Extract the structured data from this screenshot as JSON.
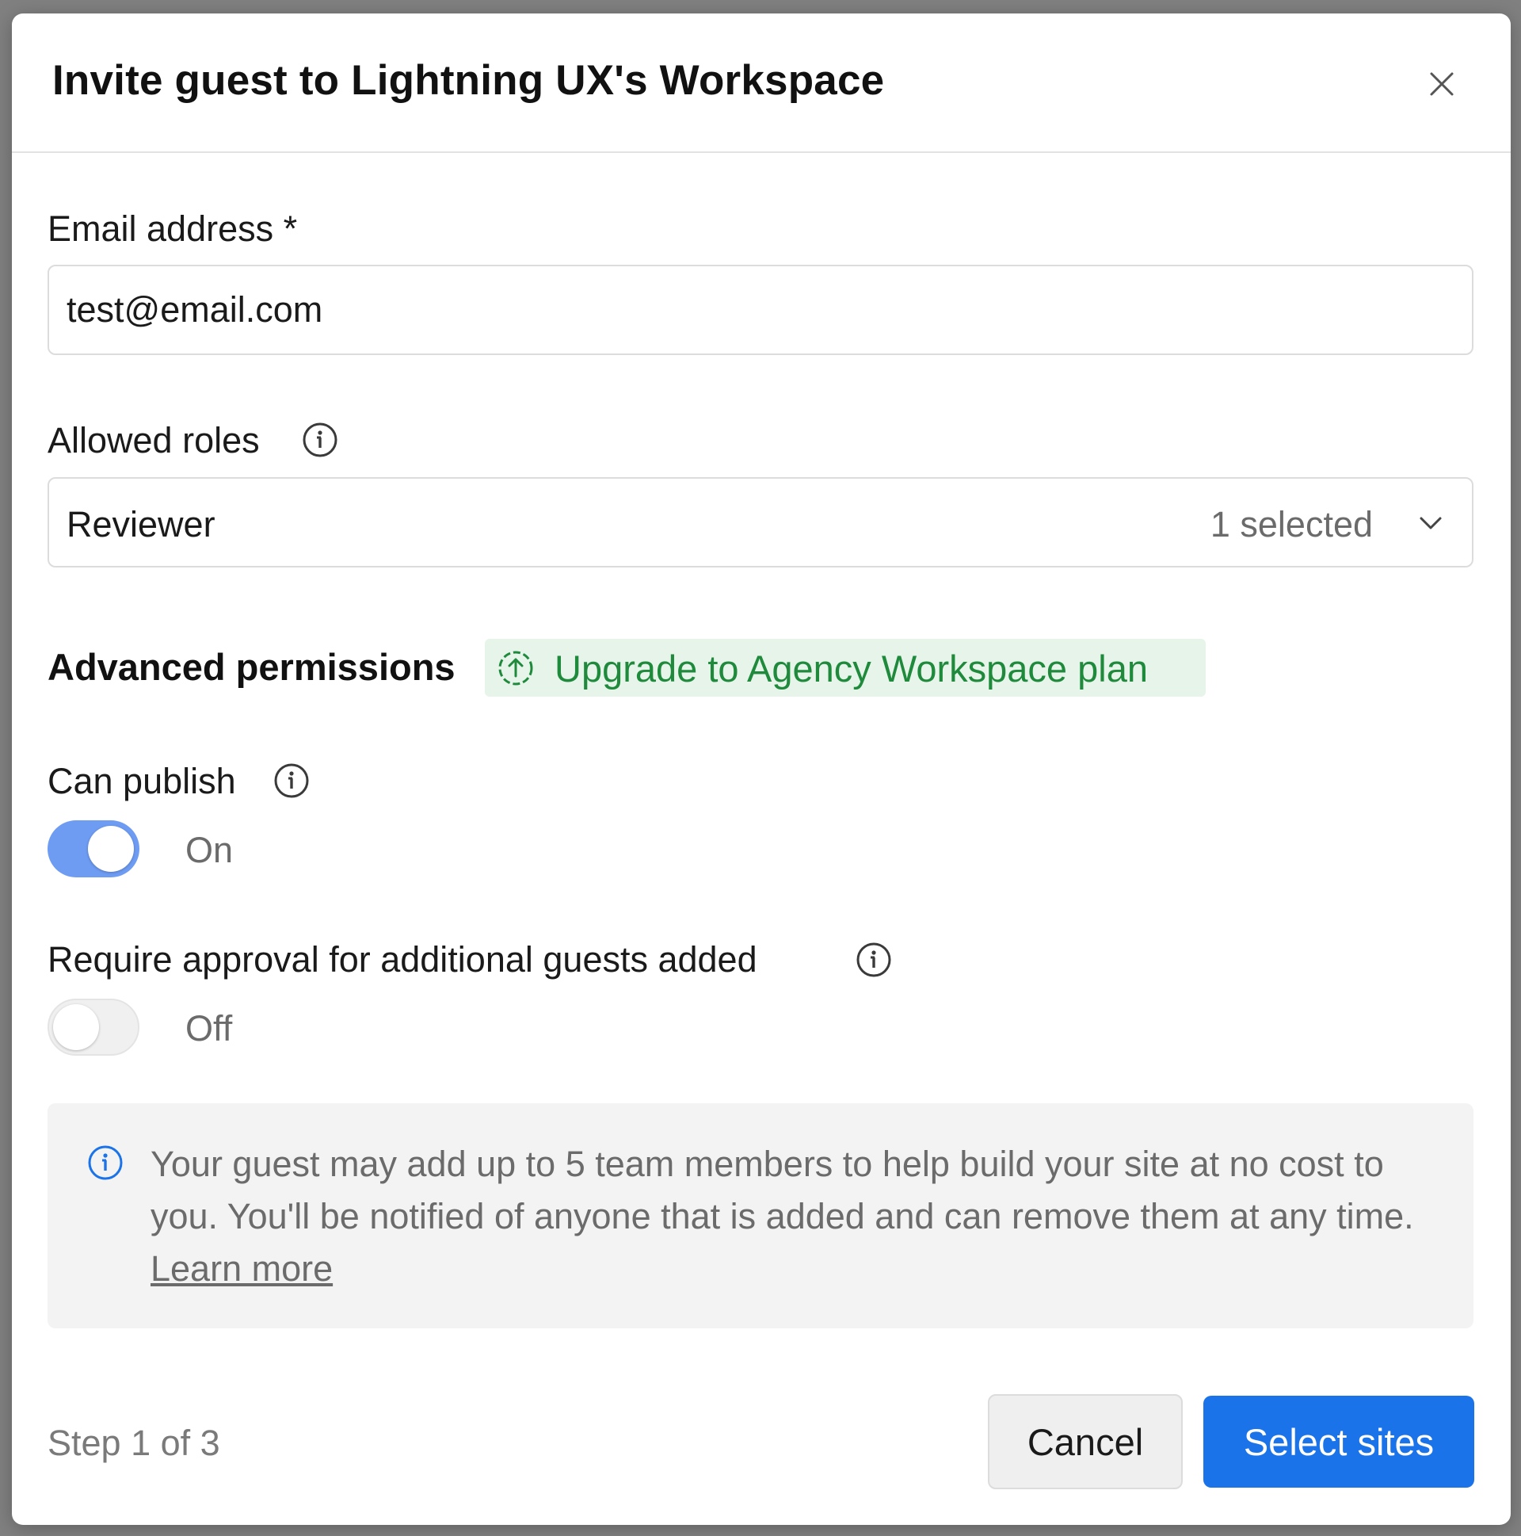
{
  "modal": {
    "title": "Invite guest to Lightning UX's Workspace"
  },
  "email": {
    "label": "Email address",
    "required_mark": "*",
    "value": "test@email.com"
  },
  "roles": {
    "label": "Allowed roles",
    "selected_value": "Reviewer",
    "selected_count": "1 selected"
  },
  "advanced": {
    "title": "Advanced permissions",
    "upgrade_label": "Upgrade to Agency Workspace plan"
  },
  "can_publish": {
    "label": "Can publish",
    "state_label": "On",
    "enabled": true
  },
  "require_approval": {
    "label": "Require approval for additional guests added",
    "state_label": "Off",
    "enabled": false
  },
  "notice": {
    "text": "Your guest may add up to 5 team members to help build your site at no cost to you. You'll be notified of anyone that is added and can remove them at any time.",
    "link_label": "Learn more"
  },
  "footer": {
    "step_text": "Step 1 of 3",
    "cancel_label": "Cancel",
    "primary_label": "Select sites"
  },
  "colors": {
    "primary": "#1a73e8",
    "toggle_on": "#6e9cf3",
    "upgrade_bg": "#e6f4ea",
    "upgrade_text": "#1f8a3c",
    "info_icon": "#1a73e8"
  },
  "icons": {
    "close": "close-icon",
    "info": "info-icon",
    "upgrade": "upgrade-arrow-icon",
    "chevron": "chevron-down-icon"
  }
}
